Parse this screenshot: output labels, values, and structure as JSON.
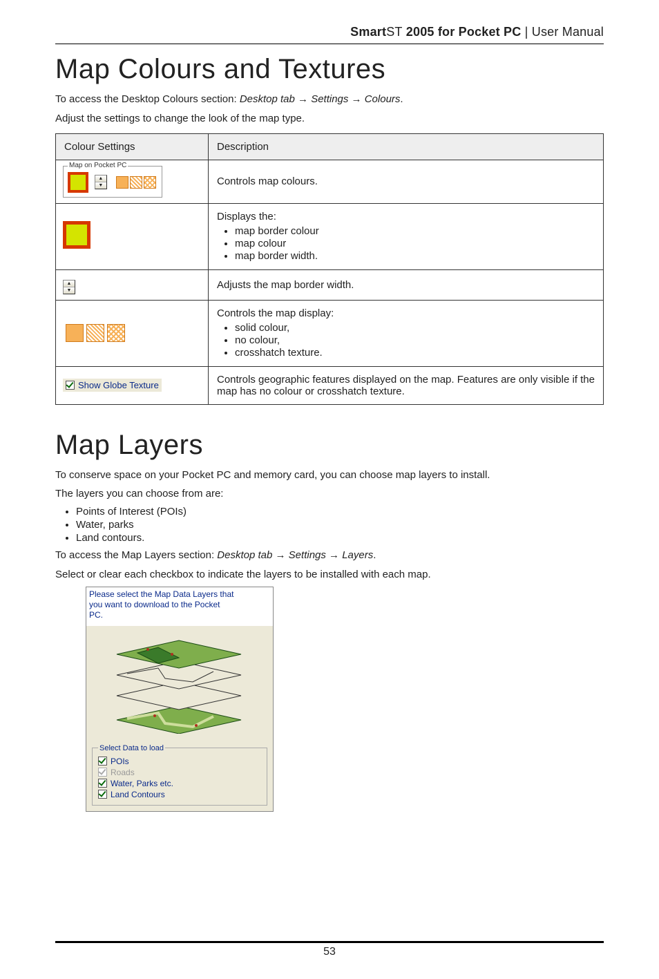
{
  "header": {
    "brand_bold": "Smart",
    "brand_thin": "ST",
    "product_bold": " 2005 for Pocket PC",
    "separator": " | ",
    "doc_type": "User Manual"
  },
  "section1": {
    "title": "Map Colours and Textures",
    "intro_prefix": "To access the ",
    "intro_bold": "Desktop Colours",
    "intro_mid": " section: ",
    "intro_path": "Desktop tab → Settings → Colours",
    "intro_suffix": ".",
    "adjust_line": "Adjust the settings to change the look of the map type.",
    "table": {
      "head_col1": "Colour Settings",
      "head_col2": "Description",
      "row1": {
        "group_legend": "Map on Pocket PC",
        "desc": "Controls map colours."
      },
      "row2": {
        "desc_line": "Displays the:",
        "b1": "map border colour",
        "b2": "map colour",
        "b3": "map border width."
      },
      "row3": {
        "desc": "Adjusts the map border width."
      },
      "row4": {
        "desc_line": "Controls the map display:",
        "b1": "solid colour,",
        "b2": "no colour,",
        "b3": "crosshatch texture."
      },
      "row5": {
        "chk_label": "Show Globe Texture",
        "desc": "Controls geographic features displayed on the map. Features are only visible if the map has no colour or crosshatch texture."
      }
    }
  },
  "section2": {
    "title": "Map Layers",
    "p1": "To conserve space on your Pocket PC and memory card, you can choose map layers to install.",
    "p2": "The layers you can choose from are:",
    "b1": "Points of Interest (POIs)",
    "b2": "Water, parks",
    "b3": "Land contours.",
    "access_prefix": "To access the ",
    "access_bold": "Map Layers",
    "access_mid": " section: ",
    "access_path": "Desktop tab → Settings → Layers",
    "access_suffix": ".",
    "select_line": "Select or clear each checkbox to indicate the layers to be installed with each map.",
    "panel": {
      "instruction": "Please select the Map Data Layers that\nyou want to download to the Pocket\nPC.",
      "legend": "Select Data to load",
      "opt1": "POIs",
      "opt2": "Roads",
      "opt3": "Water, Parks etc.",
      "opt4": "Land Contours"
    }
  },
  "page_number": "53"
}
